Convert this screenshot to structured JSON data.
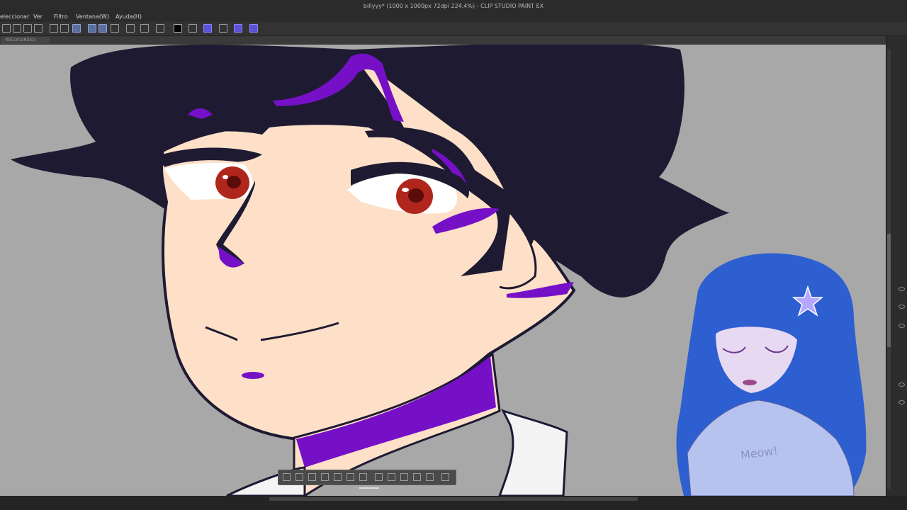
{
  "window": {
    "title": "billyyy* (1000 x 1000px 72dpi 224.4%) - CLIP STUDIO PAINT EX"
  },
  "menu": {
    "items": [
      "eleccionar",
      "Ver",
      "Filtro",
      "Ventana(W)",
      "Ayuda(H)"
    ]
  },
  "document_tab": {
    "label": "KELLYCURSED"
  },
  "colors": {
    "skin": "#fde0c7",
    "hair": "#1e1a32",
    "purple": "#7610c7",
    "eye": "#b0261c",
    "canvas_bg": "#a8a8a8",
    "vtuber_hair": "#2d5fd1",
    "vtuber_sweater": "#b7c3ef"
  },
  "vtuber": {
    "sweater_text": "Meow!"
  }
}
